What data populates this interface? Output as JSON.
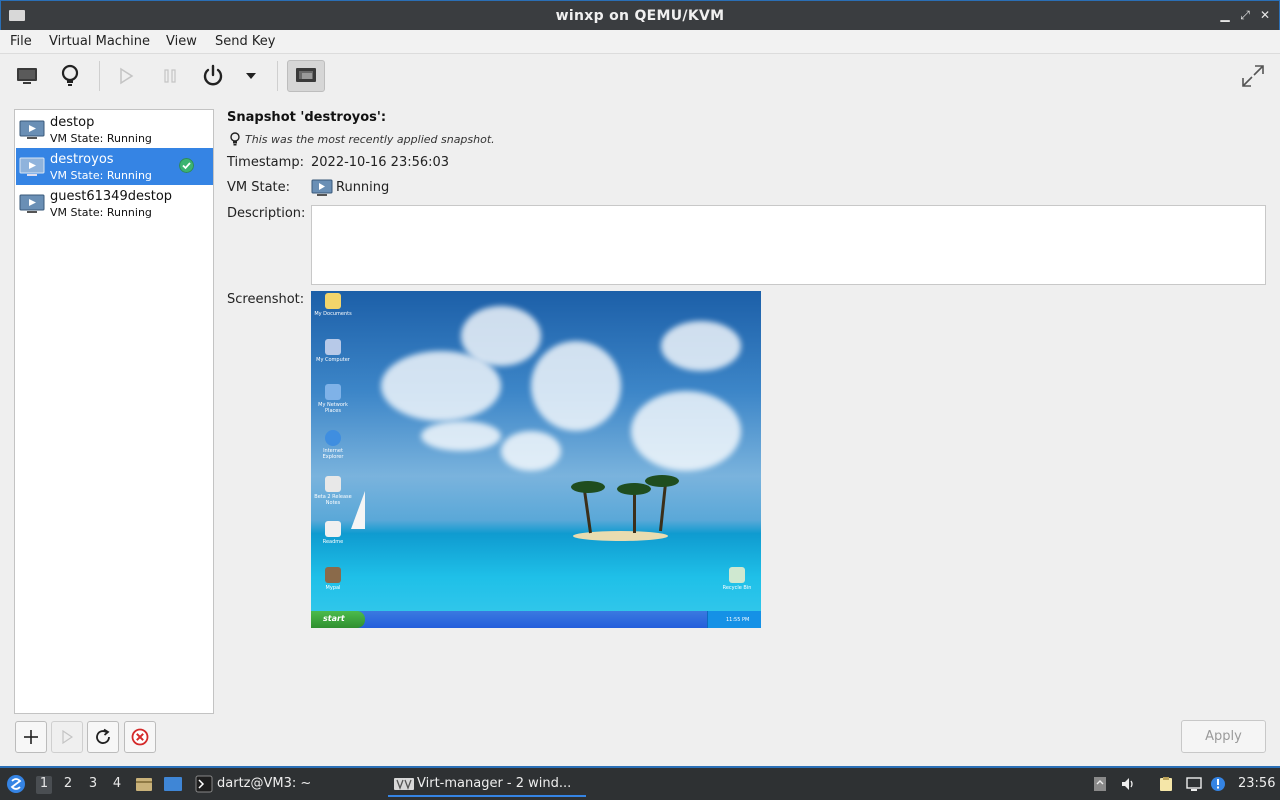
{
  "window": {
    "title": "winxp on QEMU/KVM",
    "controls": {
      "minimize": "▁",
      "restore": "⤢",
      "close": "✕"
    }
  },
  "menu": {
    "file": "File",
    "virtual_machine": "Virtual Machine",
    "view": "View",
    "send_key": "Send Key"
  },
  "toolbar": {
    "icons": [
      "monitor-icon",
      "lightbulb-icon",
      "play-icon",
      "pause-icon",
      "power-icon",
      "dropdown-arrow-icon",
      "snapshots-icon",
      "fullscreen-icon"
    ],
    "snapshots_active": true
  },
  "snapshots": [
    {
      "name": "destop",
      "state": "VM State: Running",
      "selected": false,
      "current": false
    },
    {
      "name": "destroyos",
      "state": "VM State: Running",
      "selected": true,
      "current": true
    },
    {
      "name": "guest61349destop",
      "state": "VM State: Running",
      "selected": false,
      "current": false
    }
  ],
  "details": {
    "title": "Snapshot 'destroyos':",
    "hint": "This was the most recently applied snapshot.",
    "timestamp_label": "Timestamp:",
    "timestamp_value": "2022-10-16 23:56:03",
    "state_label": "VM State:",
    "state_value": "Running",
    "description_label": "Description:",
    "description_value": "",
    "screenshot_label": "Screenshot:"
  },
  "screenshot": {
    "desktop_icons": [
      "My Documents",
      "My Computer",
      "My Network Places",
      "Internet Explorer",
      "Beta 2 Release Notes",
      "Readme",
      "Mypal",
      "Recycle Bin"
    ],
    "start_label": "start",
    "tray_time": "11:55 PM"
  },
  "list_buttons": [
    "add-snapshot-button",
    "run-snapshot-button",
    "refresh-button",
    "delete-snapshot-button"
  ],
  "apply_label": "Apply",
  "panel": {
    "workspaces": [
      "1",
      "2",
      "3",
      "4"
    ],
    "active_workspace": "1",
    "tasks": [
      {
        "label": "dartz@VM3: ~",
        "icon": "terminal-icon"
      },
      {
        "label": "Virt-manager - 2 wind...",
        "icon": "virt-manager-icon"
      }
    ],
    "clock": "23:56"
  },
  "colors": {
    "selection": "#3584e4",
    "window_border": "#2a6fb6",
    "titlebar": "#3a3d40",
    "panel": "#2e3133",
    "current_check": "#3cb371"
  }
}
